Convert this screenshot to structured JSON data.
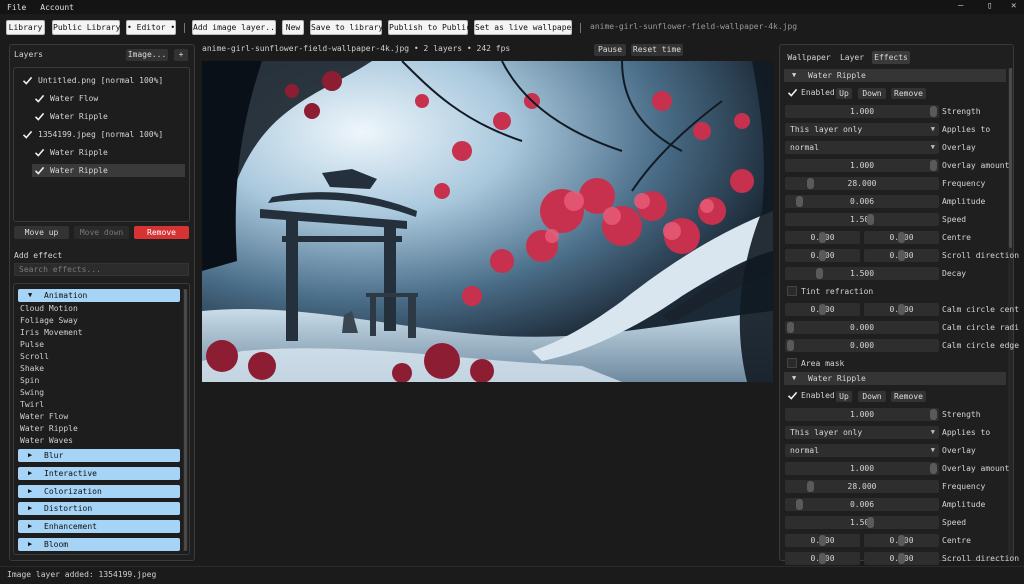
{
  "menu": {
    "file": "File",
    "account": "Account",
    "minimize": "—",
    "maximize": "▯",
    "close": "✕"
  },
  "toolbar": {
    "library": "Library",
    "public_library": "Public Library",
    "editor": "• Editor •",
    "add_image_layer": "Add image layer...",
    "new": "New",
    "save_to_library": "Save to library",
    "publish": "Publish to Public",
    "set_wallpaper": "Set as live wallpaper",
    "filename": "anime-girl-sunflower-field-wallpaper-4k.jpg"
  },
  "layers": {
    "title": "Layers",
    "image_button": "Image...",
    "add_button": "+",
    "tree": [
      {
        "label": "Untitled.png  [normal 100%]",
        "checked": true,
        "indent": 0
      },
      {
        "label": "Water Flow",
        "checked": true,
        "indent": 1
      },
      {
        "label": "Water Ripple",
        "checked": true,
        "indent": 1
      },
      {
        "label": "1354199.jpeg  [normal 100%]",
        "checked": true,
        "indent": 0
      },
      {
        "label": "Water Ripple",
        "checked": true,
        "indent": 1
      },
      {
        "label": "Water Ripple",
        "checked": true,
        "indent": 1,
        "selected": true
      }
    ],
    "move_up": "Move up",
    "move_down": "Move down",
    "remove": "Remove"
  },
  "add_effect": {
    "title": "Add effect",
    "search_placeholder": "Search effects...",
    "animation": {
      "label": "Animation",
      "items": [
        "Cloud Motion",
        "Foliage Sway",
        "Iris Movement",
        "Pulse",
        "Scroll",
        "Shake",
        "Spin",
        "Swing",
        "Twirl",
        "Water Flow",
        "Water Ripple",
        "Water Waves"
      ]
    },
    "categories": [
      "Blur",
      "Interactive",
      "Colorization",
      "Distortion",
      "Enhancement",
      "Bloom"
    ]
  },
  "canvas": {
    "info": "anime-girl-sunflower-field-wallpaper-4k.jpg • 2 layers • 242 fps",
    "pause": "Pause",
    "reset_time": "Reset time"
  },
  "right_tabs": [
    "Wallpaper",
    "Layer",
    "Effects"
  ],
  "effect1": {
    "title": "Water Ripple",
    "enabled": "Enabled",
    "up": "Up",
    "down": "Down",
    "remove": "Remove",
    "strength": {
      "value": "1.000",
      "label": "Strength",
      "level": 1.0
    },
    "applies_to": {
      "value": "This layer only",
      "label": "Applies to"
    },
    "overlay": {
      "value": "normal",
      "label": "Overlay"
    },
    "overlay_amount": {
      "value": "1.000",
      "label": "Overlay amount",
      "level": 1.0
    },
    "frequency": {
      "value": "28.000",
      "label": "Frequency",
      "level": 0.14
    },
    "amplitude": {
      "value": "0.006",
      "label": "Amplitude",
      "level": 0.06
    },
    "speed": {
      "value": "1.500",
      "label": "Speed",
      "level": 0.56
    },
    "centre": {
      "x": "0.500",
      "y": "0.500",
      "label": "Centre"
    },
    "scroll_direction": {
      "x": "0.000",
      "y": "0.000",
      "label": "Scroll direction"
    },
    "decay": {
      "value": "1.500",
      "label": "Decay",
      "level": 0.2
    },
    "tint_refraction": "Tint refraction",
    "calm_circle_centre": {
      "x": "0.500",
      "y": "0.500",
      "label": "Calm circle cent"
    },
    "calm_circle_radius": {
      "value": "0.000",
      "label": "Calm circle radi",
      "level": 0.0
    },
    "calm_circle_edge": {
      "value": "0.000",
      "label": "Calm circle edge",
      "level": 0.0
    },
    "area_mask": "Area mask"
  },
  "effect2": {
    "title": "Water Ripple",
    "enabled": "Enabled",
    "up": "Up",
    "down": "Down",
    "remove": "Remove",
    "strength": {
      "value": "1.000",
      "label": "Strength",
      "level": 1.0
    },
    "applies_to": {
      "value": "This layer only",
      "label": "Applies to"
    },
    "overlay": {
      "value": "normal",
      "label": "Overlay"
    },
    "overlay_amount": {
      "value": "1.000",
      "label": "Overlay amount",
      "level": 1.0
    },
    "frequency": {
      "value": "28.000",
      "label": "Frequency",
      "level": 0.14
    },
    "amplitude": {
      "value": "0.006",
      "label": "Amplitude",
      "level": 0.06
    },
    "speed": {
      "value": "1.500",
      "label": "Speed",
      "level": 0.56
    },
    "centre": {
      "x": "0.500",
      "y": "0.500",
      "label": "Centre"
    },
    "scroll_direction": {
      "x": "0.000",
      "y": "0.000",
      "label": "Scroll direction"
    }
  },
  "status": "Image layer added: 1354199.jpeg",
  "colors": {
    "accent": "#a6d4f7",
    "danger": "#d63434",
    "background": "#1b1b1b",
    "panel": "#1f1f1f"
  }
}
